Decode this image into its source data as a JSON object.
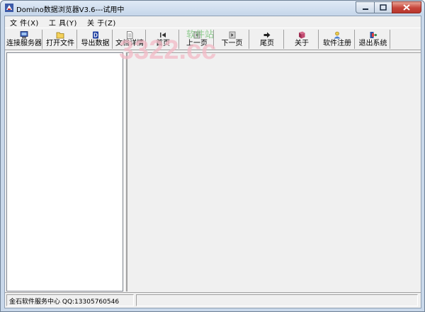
{
  "window": {
    "title": "Domino数据浏览器V3.6---试用中"
  },
  "menu": [
    {
      "label": "文 件(X)"
    },
    {
      "label": "工 具(Y)"
    },
    {
      "label": "关 于(Z)"
    }
  ],
  "toolbar": [
    {
      "label": "连接服务器",
      "icon": "computer-icon",
      "name": "connect-server-button"
    },
    {
      "label": "打开文件",
      "icon": "folder-icon",
      "name": "open-file-button"
    },
    {
      "label": "导出数据",
      "icon": "export-icon",
      "name": "export-data-button"
    },
    {
      "label": "文档详情",
      "icon": "document-icon",
      "name": "document-details-button"
    },
    {
      "label": "首页",
      "icon": "first-page-icon",
      "name": "first-page-button"
    },
    {
      "label": "上一页",
      "icon": "prev-page-icon",
      "name": "prev-page-button"
    },
    {
      "label": "下一页",
      "icon": "next-page-icon",
      "name": "next-page-button"
    },
    {
      "label": "尾页",
      "icon": "last-page-icon",
      "name": "last-page-button"
    },
    {
      "label": "关于",
      "icon": "book-icon",
      "name": "about-button"
    },
    {
      "label": "软件注册",
      "icon": "register-icon",
      "name": "register-button"
    },
    {
      "label": "退出系统",
      "icon": "exit-icon",
      "name": "exit-button"
    }
  ],
  "status": {
    "text": "金石软件服务中心 QQ:13305760546"
  },
  "watermark": {
    "brand": "3322.cc",
    "caption": "软件站"
  }
}
